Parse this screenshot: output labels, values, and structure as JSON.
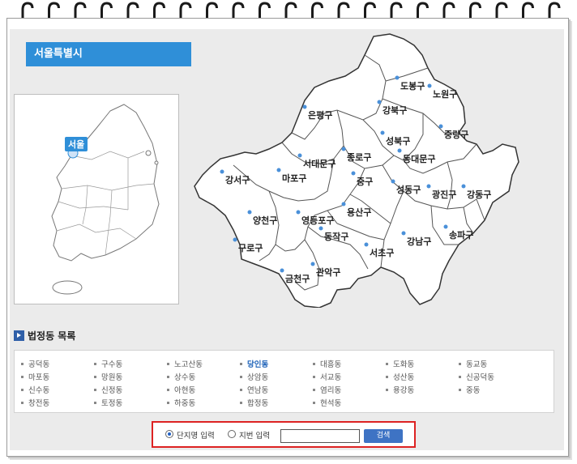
{
  "region": {
    "title": "서울특별시",
    "korea_label": "서울"
  },
  "districts": [
    {
      "name": "도봉구"
    },
    {
      "name": "노원구"
    },
    {
      "name": "강북구"
    },
    {
      "name": "은평구"
    },
    {
      "name": "성북구"
    },
    {
      "name": "중랑구"
    },
    {
      "name": "종로구"
    },
    {
      "name": "서대문구"
    },
    {
      "name": "동대문구"
    },
    {
      "name": "강서구"
    },
    {
      "name": "마포구"
    },
    {
      "name": "중구"
    },
    {
      "name": "성동구"
    },
    {
      "name": "광진구"
    },
    {
      "name": "강동구"
    },
    {
      "name": "용산구"
    },
    {
      "name": "양천구"
    },
    {
      "name": "영등포구"
    },
    {
      "name": "동작구"
    },
    {
      "name": "구로구"
    },
    {
      "name": "서초구"
    },
    {
      "name": "강남구"
    },
    {
      "name": "송파구"
    },
    {
      "name": "관악구"
    },
    {
      "name": "금천구"
    }
  ],
  "dong_section": {
    "title": "법정동 목록",
    "active": "당인동"
  },
  "dongs": [
    "공덕동",
    "구수동",
    "노고산동",
    "당인동",
    "대흥동",
    "도화동",
    "동교동",
    "마포동",
    "망원동",
    "상수동",
    "상암동",
    "서교동",
    "성산동",
    "신공덕동",
    "신수동",
    "신정동",
    "아현동",
    "연남동",
    "염리동",
    "용강동",
    "중동",
    "창전동",
    "토정동",
    "하중동",
    "합정동",
    "현석동"
  ],
  "search": {
    "option1": "단지명 입력",
    "option2": "지번 입력",
    "selected": "단지명 입력",
    "input_value": "",
    "button_label": "검색"
  },
  "colors": {
    "accent": "#2f8fd8",
    "highlight_border": "#dd2222",
    "button": "#3e73c4",
    "district_dot": "#4a90d9"
  }
}
